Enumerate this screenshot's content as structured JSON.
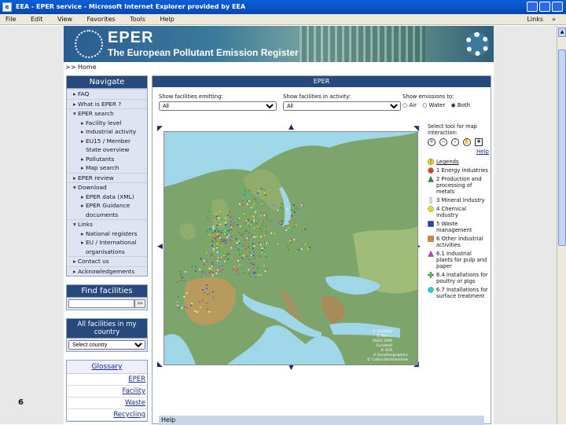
{
  "window": {
    "title": "EEA - EPER service - Microsoft Internet Explorer provided by EEA",
    "icon": "ie-icon"
  },
  "menu": {
    "items": [
      "File",
      "Edit",
      "View",
      "Favorites",
      "Tools",
      "Help"
    ],
    "links": "Links",
    "more": "»"
  },
  "banner": {
    "title": "EPER",
    "subtitle": "The European Pollutant Emission Register"
  },
  "breadcrumb": ">> Home",
  "sidebar": {
    "nav_title": "Navigate",
    "nav": [
      {
        "label": "FAQ",
        "level": 0,
        "mark": "▸"
      },
      {
        "label": "What is EPER ?",
        "level": 0,
        "mark": "▸"
      },
      {
        "label": "EPER search",
        "level": 0,
        "mark": "▾"
      },
      {
        "label": "Facility level",
        "level": 1,
        "mark": "▸"
      },
      {
        "label": "Industrial activity",
        "level": 1,
        "mark": "▸"
      },
      {
        "label": "EU15 / Member",
        "level": 1,
        "mark": "▸"
      },
      {
        "label": "State overview",
        "level": 1,
        "mark": ""
      },
      {
        "label": "Pollutants",
        "level": 1,
        "mark": "▸"
      },
      {
        "label": "Map search",
        "level": 1,
        "mark": "▸"
      },
      {
        "label": "EPER review",
        "level": 0,
        "mark": "▸"
      },
      {
        "label": "Download",
        "level": 0,
        "mark": "▾"
      },
      {
        "label": "EPER data (XML)",
        "level": 1,
        "mark": "▸"
      },
      {
        "label": "EPER Guidance",
        "level": 1,
        "mark": "▸"
      },
      {
        "label": "documents",
        "level": 1,
        "mark": ""
      },
      {
        "label": "Links",
        "level": 0,
        "mark": "▾"
      },
      {
        "label": "National registers",
        "level": 1,
        "mark": "▸"
      },
      {
        "label": "EU / International",
        "level": 1,
        "mark": "▸"
      },
      {
        "label": "organisations",
        "level": 1,
        "mark": ""
      },
      {
        "label": "Contact us",
        "level": 0,
        "mark": "▸"
      },
      {
        "label": "Acknowledgements",
        "level": 0,
        "mark": "▸"
      }
    ],
    "find_title": "Find facilities",
    "find_button": ">>",
    "country_title": "All facilities in my country",
    "country_select": "Select country",
    "glossary_title": "Glossary",
    "glossary": [
      "EPER",
      "Facility",
      "Waste",
      "Recycling"
    ]
  },
  "page_number": "6",
  "main": {
    "header": "EPER",
    "filter_emitting_label": "Show facilities emitting:",
    "filter_emitting_value": "All",
    "filter_activity_label": "Show facilities in activity:",
    "filter_activity_value": "All",
    "emissions_label": "Show emissions to:",
    "emissions_options": [
      "Air",
      "Water",
      "Both"
    ],
    "emissions_selected": "Both",
    "tool_prompt": "Select tool for map interaction:",
    "help_link": "Help",
    "legend_title": "Legends",
    "legend": [
      {
        "label": "1 Energy industries",
        "color": "#e23b2b",
        "shape": "circle"
      },
      {
        "label": "2 Production and processing of metals",
        "color": "#1f9a3a",
        "shape": "triangle"
      },
      {
        "label": "3 Mineral Industry",
        "color": "#ffffff",
        "shape": "bar"
      },
      {
        "label": "4 Chemical industry",
        "color": "#e8e000",
        "shape": "circle"
      },
      {
        "label": "5 Waste management",
        "color": "#2b3db8",
        "shape": "square"
      },
      {
        "label": "6 Other industrial activities",
        "color": "#d88a2a",
        "shape": "square"
      },
      {
        "label": "6.1 Industrial plants for pulp and paper",
        "color": "#c23ad0",
        "shape": "triangle"
      },
      {
        "label": "6.4 Installations for poultry or pigs",
        "color": "#3bd24a",
        "shape": "plus"
      },
      {
        "label": "6.7 Installations for surface treatment",
        "color": "#1fd0e0",
        "shape": "circle"
      }
    ],
    "map_credit": [
      "© EC/2004",
      "© Wor.../",
      "USGS 1996",
      "Eurostat/",
      "© EEA",
      "© EuroGeographics",
      "© Collins Bartholomew"
    ],
    "help_bar": "Help"
  },
  "colors": {
    "navy": "#27497c",
    "sea": "#9fd7e8",
    "land": "#7da46a"
  }
}
